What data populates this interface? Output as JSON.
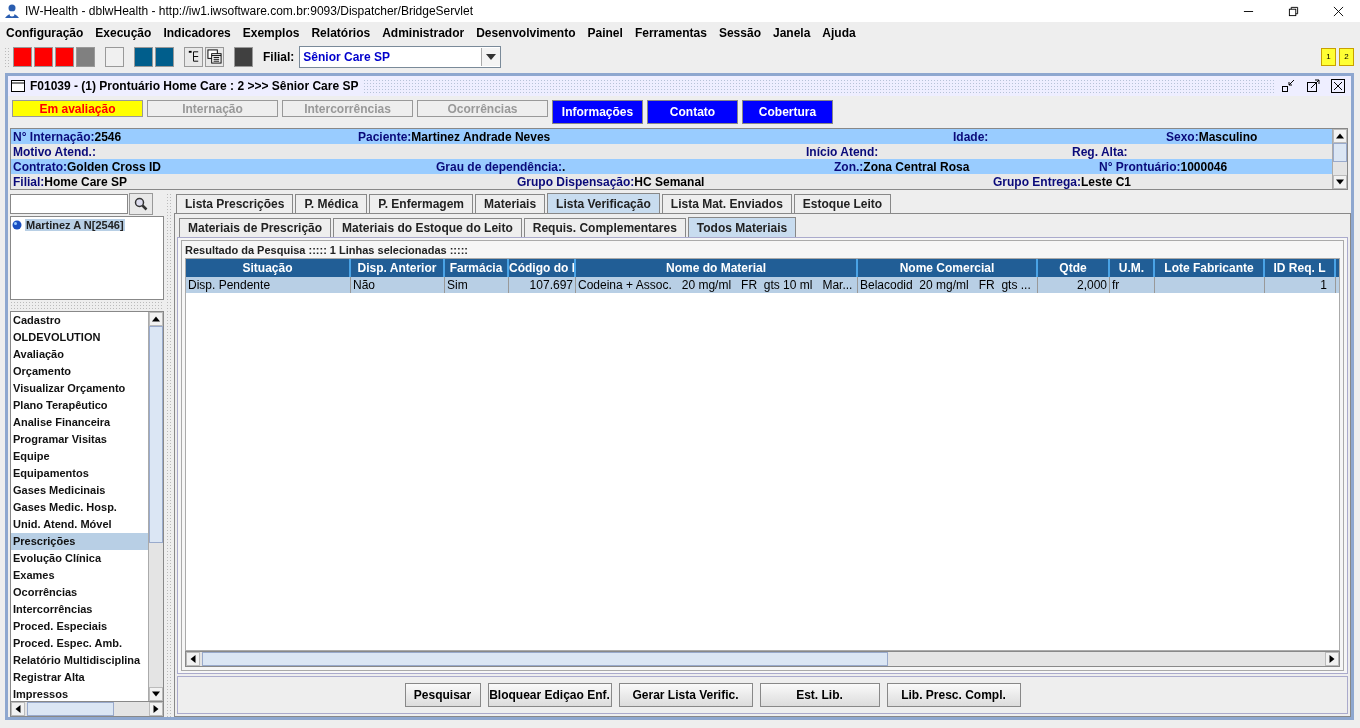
{
  "window": {
    "title": "IW-Health - dblwHealth - http://iw1.iwsoftware.com.br:9093/Dispatcher/BridgeServlet"
  },
  "menu": [
    "Configuração",
    "Execução",
    "Indicadores",
    "Exemplos",
    "Relatórios",
    "Administrador",
    "Desenvolvimento",
    "Painel",
    "Ferramentas",
    "Sessão",
    "Janela",
    "Ajuda"
  ],
  "toolbar": {
    "color_buttons": [
      {
        "color": "#ff0000"
      },
      {
        "color": "#ff0000"
      },
      {
        "color": "#ff0000"
      },
      {
        "color": "#808080"
      },
      {
        "color": "#f0f0f0"
      },
      {
        "color": "#005e8c"
      },
      {
        "color": "#005e8c"
      }
    ],
    "filial_label": "Filial:",
    "filial_value": "Sênior Care SP",
    "corner_buttons": [
      "1",
      "2"
    ]
  },
  "frame": {
    "title": "F01039 - (1) Prontuário Home Care : 2 >>> Sênior Care SP"
  },
  "status_buttons": [
    {
      "label": "Em avaliação",
      "kind": "alert"
    },
    {
      "label": "Internação",
      "kind": "disabled"
    },
    {
      "label": "Intercorrências",
      "kind": "disabled"
    },
    {
      "label": "Ocorrências",
      "kind": "disabled"
    },
    {
      "label": "Informações",
      "kind": "active"
    },
    {
      "label": "Contato",
      "kind": "active"
    },
    {
      "label": "Cobertura",
      "kind": "active"
    }
  ],
  "info_rows": [
    [
      {
        "label": "N° Internação:",
        "value": "2546"
      },
      {
        "label": "Paciente:",
        "value": "Martinez Andrade Neves"
      },
      {
        "label": "Idade:"
      },
      {
        "label": "Sexo:",
        "value": "Masculino"
      }
    ],
    [
      {
        "label": "Motivo Atend.:"
      },
      {
        "label": "Início Atend:"
      },
      {
        "label": "Reg. Alta:"
      }
    ],
    [
      {
        "label": "Contrato:",
        "value": "Golden Cross ID"
      },
      {
        "label": "Grau de dependência:",
        "value": "."
      },
      {
        "label": "Zon.:",
        "value": "Zona Central Rosa"
      },
      {
        "label": "N° Prontuário:",
        "value": "1000046"
      }
    ],
    [
      {
        "label": "Filial:",
        "value": "Home Care SP"
      },
      {
        "label": "Grupo Dispensação:",
        "value": "HC Semanal"
      },
      {
        "label": "Grupo Entrega:",
        "value": "Leste C1"
      }
    ]
  ],
  "patient_tree": [
    {
      "label": "Martinez A N[2546]",
      "selected": true
    }
  ],
  "side_menu": [
    {
      "label": "Cadastro",
      "selected": false
    },
    {
      "label": "OLDEVOLUTION",
      "selected": false
    },
    {
      "label": "Avaliação",
      "selected": false
    },
    {
      "label": "Orçamento",
      "selected": false
    },
    {
      "label": "Visualizar Orçamento",
      "selected": false
    },
    {
      "label": "Plano Terapêutico",
      "selected": false
    },
    {
      "label": "Analise Financeira",
      "selected": false
    },
    {
      "label": "Programar Visitas",
      "selected": false
    },
    {
      "label": "Equipe",
      "selected": false
    },
    {
      "label": "Equipamentos",
      "selected": false
    },
    {
      "label": "Gases Medicinais",
      "selected": false
    },
    {
      "label": "Gases Medic. Hosp.",
      "selected": false
    },
    {
      "label": "Unid. Atend. Móvel",
      "selected": false
    },
    {
      "label": "Prescrições",
      "selected": true
    },
    {
      "label": "Evolução Clínica",
      "selected": false
    },
    {
      "label": "Exames",
      "selected": false
    },
    {
      "label": "Ocorrências",
      "selected": false
    },
    {
      "label": "Intercorrências",
      "selected": false
    },
    {
      "label": "Proced. Especiais",
      "selected": false
    },
    {
      "label": "Proced. Espec. Amb.",
      "selected": false
    },
    {
      "label": "Relatório Multidisciplina",
      "selected": false
    },
    {
      "label": "Registrar Alta",
      "selected": false
    },
    {
      "label": "Impressos",
      "selected": false
    }
  ],
  "tabs": [
    {
      "label": "Lista Prescrições",
      "selected": false
    },
    {
      "label": "P. Médica",
      "selected": false
    },
    {
      "label": "P. Enfermagem",
      "selected": false
    },
    {
      "label": "Materiais",
      "selected": false
    },
    {
      "label": "Lista Verificação",
      "selected": true
    },
    {
      "label": "Lista Mat. Enviados",
      "selected": false
    },
    {
      "label": "Estoque Leito",
      "selected": false
    }
  ],
  "subtabs": [
    {
      "label": "Materiais de Prescrição",
      "selected": false
    },
    {
      "label": "Materiais do Estoque do Leito",
      "selected": false
    },
    {
      "label": "Requis. Complementares",
      "selected": false
    },
    {
      "label": "Todos Materiais",
      "selected": true
    }
  ],
  "results": {
    "title": "Resultado da Pesquisa ::::: 1 Linhas selecionadas :::::",
    "columns": [
      "Situação",
      "Disp. Anterior",
      "Farmácia",
      "Código do I",
      "Nome do Material",
      "Nome Comercial",
      "Qtde",
      "U.M.",
      "Lote Fabricante",
      "ID Req. L"
    ],
    "rows": [
      {
        "selected": true,
        "cells": [
          "Disp. Pendente",
          "Não",
          "Sim",
          "107.697",
          "Codeina + Assoc.   20 mg/ml   FR  gts 10 ml   Mar...",
          "Belacodid  20 mg/ml   FR  gts ...",
          "2,000",
          "fr",
          "",
          "1"
        ]
      }
    ]
  },
  "actions": [
    "Pesquisar",
    "Bloquear Ediçao Enf.",
    "Gerar Lista Verific.",
    "Est. Lib.",
    "Lib. Presc. Compl."
  ]
}
